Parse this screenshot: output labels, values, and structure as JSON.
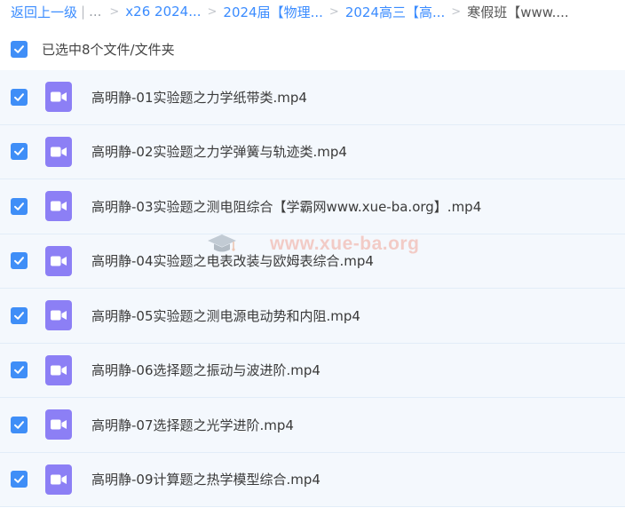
{
  "breadcrumb": {
    "back_label": "返回上一级",
    "pipe": "|",
    "dots": "...",
    "separator": ">",
    "items": [
      "x26 2024...",
      "2024届【物理...",
      "2024高三【高...",
      "寒假班【www...."
    ]
  },
  "selection": {
    "label": "已选中8个文件/文件夹",
    "checked": true
  },
  "files": [
    {
      "name": "高明静-01实验题之力学纸带类.mp4",
      "checked": true
    },
    {
      "name": "高明静-02实验题之力学弹簧与轨迹类.mp4",
      "checked": true
    },
    {
      "name": "高明静-03实验题之测电阻综合【学霸网www.xue-ba.org】.mp4",
      "checked": true
    },
    {
      "name": "高明静-04实验题之电表改装与欧姆表综合.mp4",
      "checked": true
    },
    {
      "name": "高明静-05实验题之测电源电动势和内阻.mp4",
      "checked": true
    },
    {
      "name": "高明静-06选择题之振动与波进阶.mp4",
      "checked": true
    },
    {
      "name": "高明静-07选择题之光学进阶.mp4",
      "checked": true
    },
    {
      "name": "高明静-09计算题之热学模型综合.mp4",
      "checked": true
    }
  ],
  "watermark": {
    "text": "www.xue-ba.org"
  },
  "icons": {
    "checkbox": "checkmark-icon",
    "file": "video-file-icon",
    "watermark": "graduation-cap-icon"
  },
  "colors": {
    "accent": "#3f8ef7",
    "link": "#3b8cff",
    "video_icon": "#8c7ff5",
    "row_bg": "#f4f8fd"
  }
}
